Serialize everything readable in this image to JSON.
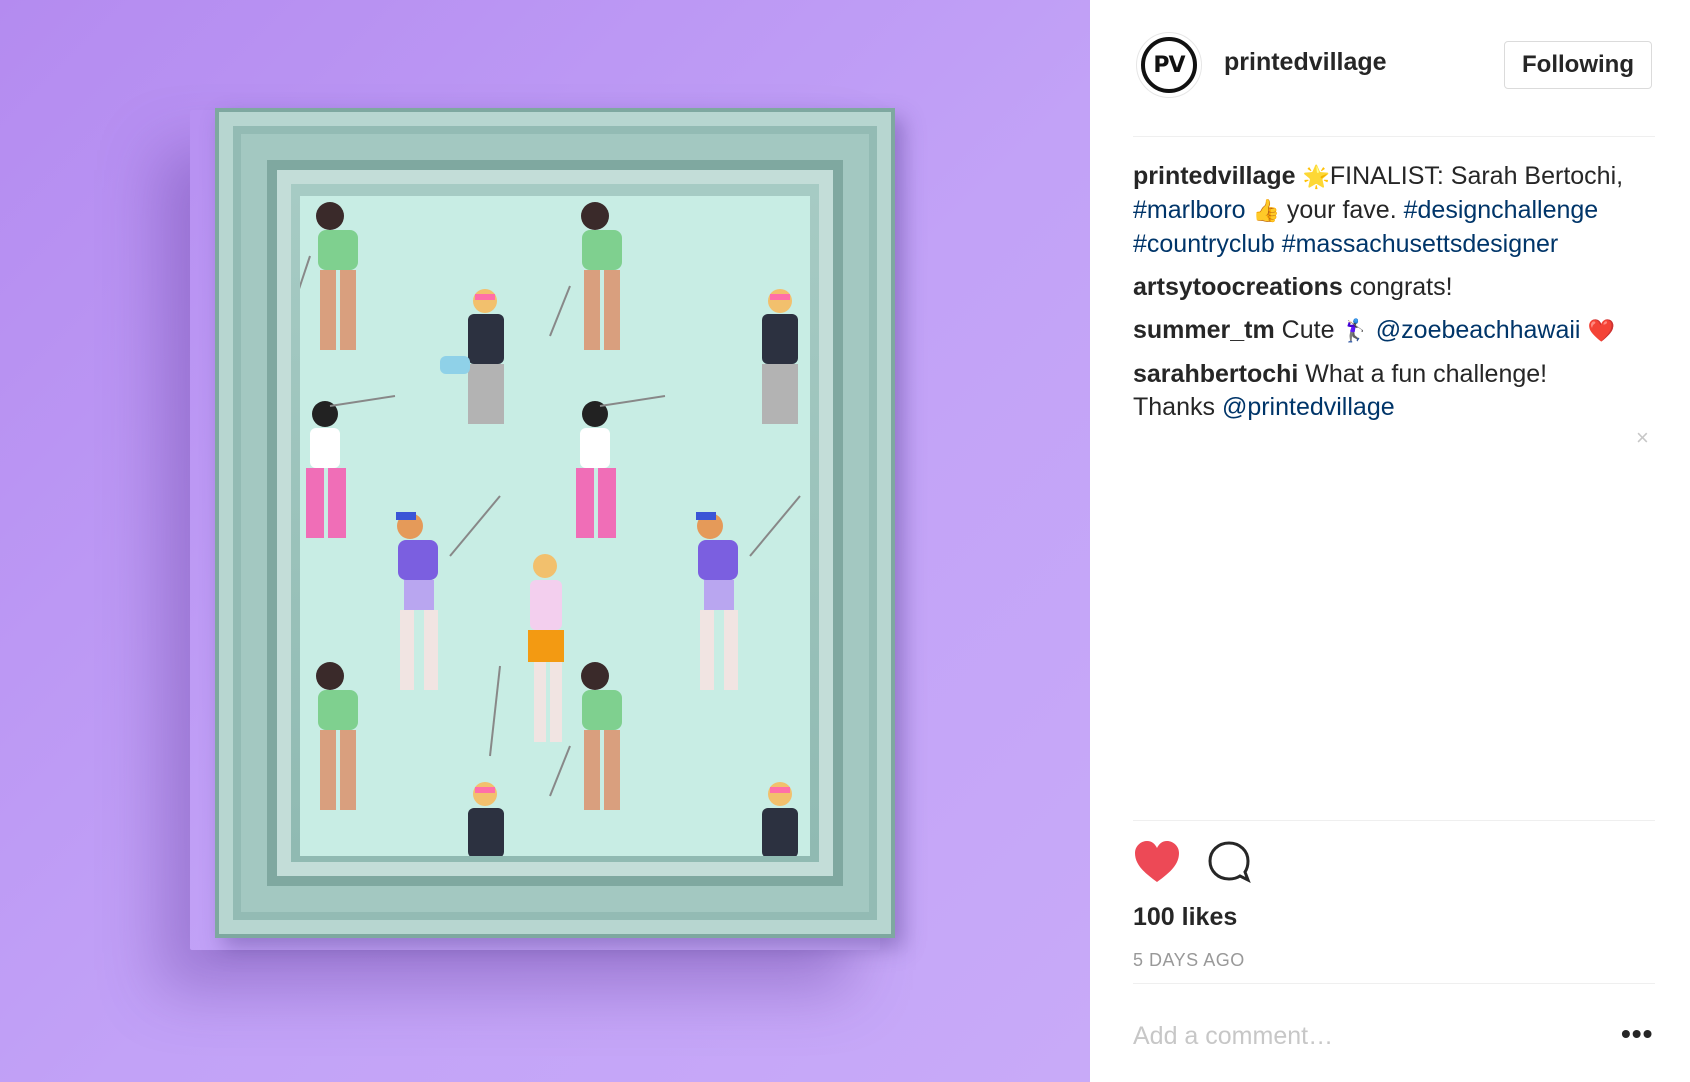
{
  "post": {
    "author": "printedvillage",
    "avatar_text": "PV",
    "follow_label": "Following",
    "caption": {
      "user": "printedvillage",
      "emoji_star": "🌟",
      "text1": "FINALIST: Sarah Bertochi,",
      "tag1": "#marlboro",
      "emoji_thumb": "👍",
      "text2": " your fave.",
      "tag2": "#designchallenge",
      "tag3": "#countryclub",
      "tag4": "#massachusettsdesigner"
    },
    "comments": [
      {
        "user": "artsytoocreations",
        "text": " congrats!"
      },
      {
        "user": "summer_tm",
        "text": " Cute ",
        "emoji": "🏌🏻‍♀",
        "mention": "@zoebeachhawaii",
        "emoji_heart": "❤️"
      },
      {
        "user": "sarahbertochi",
        "text": " What a fun challenge! Thanks ",
        "mention": "@printedvillage"
      }
    ],
    "likes": "100 likes",
    "time": "5 DAYS AGO",
    "add_comment_placeholder": "Add a comment…",
    "more_label": "•••",
    "close_label": "×"
  },
  "colors": {
    "like": "#ed4956",
    "link": "#003569",
    "muted": "#999999",
    "background": "#b48bf0"
  }
}
